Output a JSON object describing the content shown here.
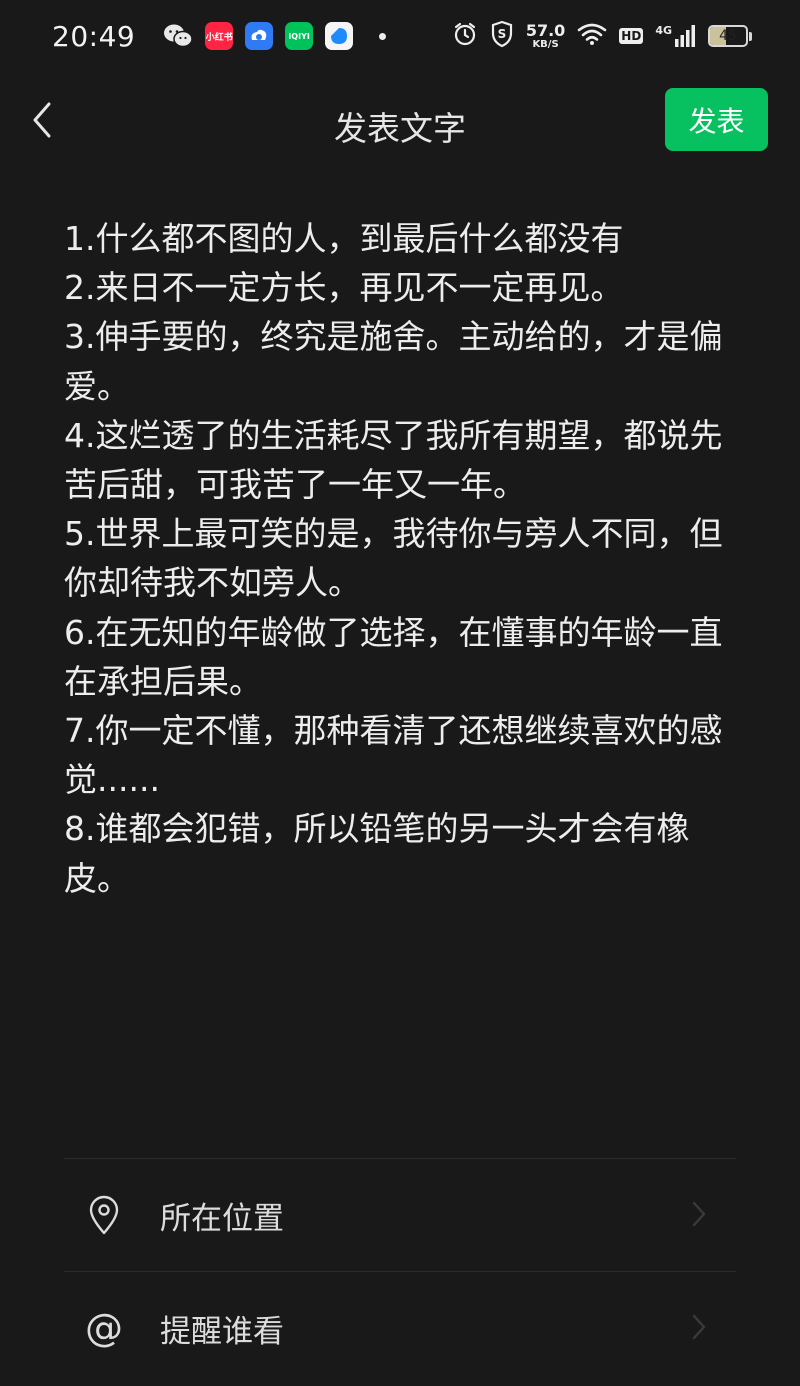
{
  "status_bar": {
    "time": "20:49",
    "apps": [
      {
        "name": "wechat-icon",
        "color": "#e8e8e8"
      },
      {
        "name": "xiaohongshu-icon",
        "label": "小红书",
        "color": "#ff2442"
      },
      {
        "name": "baidu-netdisk-icon",
        "color": "#2f7bf6"
      },
      {
        "name": "iqiyi-icon",
        "label": "iQIYI",
        "color": "#00c25a"
      },
      {
        "name": "blue-app-icon",
        "color": "#1e8cff"
      }
    ],
    "net_speed_value": "57.0",
    "net_speed_unit": "KB/S",
    "hd": "HD",
    "network_gen": "4G",
    "battery_level": "45",
    "battery_fraction": 0.45
  },
  "nav": {
    "title": "发表文字",
    "publish_label": "发表"
  },
  "composer": {
    "lines": [
      "1.什么都不图的人，到最后什么都没有",
      "2.来日不一定方长，再见不一定再见。",
      "3.伸手要的，终究是施舍。主动给的，才是偏爱。",
      "4.这烂透了的生活耗尽了我所有期望，都说先苦后甜，可我苦了一年又一年。",
      "5.世界上最可笑的是，我待你与旁人不同，但你却待我不如旁人。",
      "6.在无知的年龄做了选择，在懂事的年龄一直在承担后果。",
      "7.你一定不懂，那种看清了还想继续喜欢的感觉......",
      "8.谁都会犯错，所以铅笔的另一头才会有橡皮。"
    ]
  },
  "options": {
    "location_label": "所在位置",
    "remind_label": "提醒谁看",
    "at_symbol": "@"
  },
  "colors": {
    "background": "#191919",
    "accent": "#07c160"
  }
}
